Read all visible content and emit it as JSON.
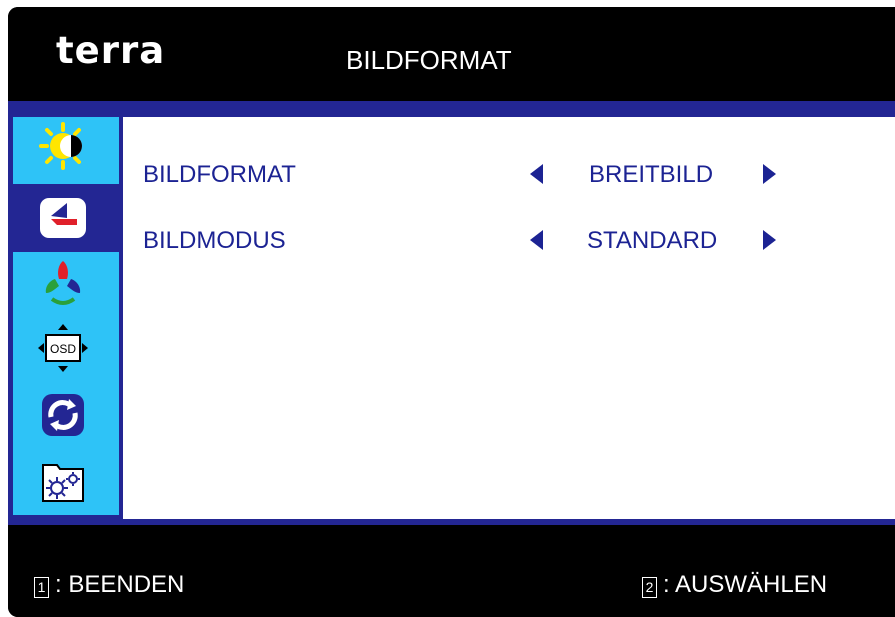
{
  "header": {
    "logo": "terra",
    "title": "BILDFORMAT"
  },
  "sidebar": {
    "items": [
      {
        "icon": "brightness-contrast-icon"
      },
      {
        "icon": "picture-format-icon",
        "selected": true
      },
      {
        "icon": "color-icon"
      },
      {
        "icon": "osd-position-icon",
        "label": "OSD"
      },
      {
        "icon": "reset-icon"
      },
      {
        "icon": "settings-icon"
      }
    ]
  },
  "menu": {
    "rows": [
      {
        "label": "BILDFORMAT",
        "value": "BREITBILD"
      },
      {
        "label": "BILDMODUS",
        "value": "STANDARD"
      }
    ]
  },
  "footer": {
    "exit_key": "1",
    "exit_label": ": BEENDEN",
    "select_key": "2",
    "select_label": ": AUSWÄHLEN"
  },
  "colors": {
    "accent": "#232693",
    "sidebar": "#2ec3f7",
    "text": "#1c2393",
    "background": "#000000"
  }
}
